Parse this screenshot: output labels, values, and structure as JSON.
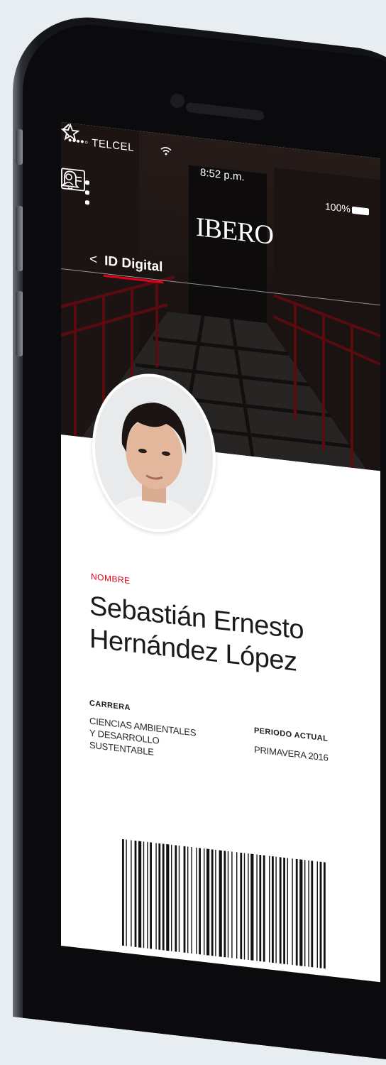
{
  "status_bar": {
    "carrier": "••••◦ TELCEL",
    "time": "8:52 p.m.",
    "battery": "100%"
  },
  "header": {
    "logo": "IBERO"
  },
  "nav": {
    "back_symbol": "<",
    "title": "ID Digital"
  },
  "profile": {
    "name_label": "NOMBRE",
    "name_line1": "Sebastián Ernesto",
    "name_line2": "Hernández López",
    "career_label": "CARRERA",
    "career_line1": "CIENCIAS AMBIENTALES",
    "career_line2": "Y DESARROLLO",
    "career_line3": "SUSTENTABLE",
    "period_label": "PERIODO ACTUAL",
    "period_value": "PRIMAVERA 2016"
  },
  "colors": {
    "accent": "#e3001b",
    "hero_dark": "#221a19",
    "text": "#1a1a1a"
  },
  "icons": {
    "menu": "menu-dots-icon",
    "bell": "bell-icon",
    "id_card": "id-card-icon",
    "share": "share-icon",
    "star": "star-icon",
    "wifi": "wifi-icon",
    "battery": "battery-icon"
  }
}
